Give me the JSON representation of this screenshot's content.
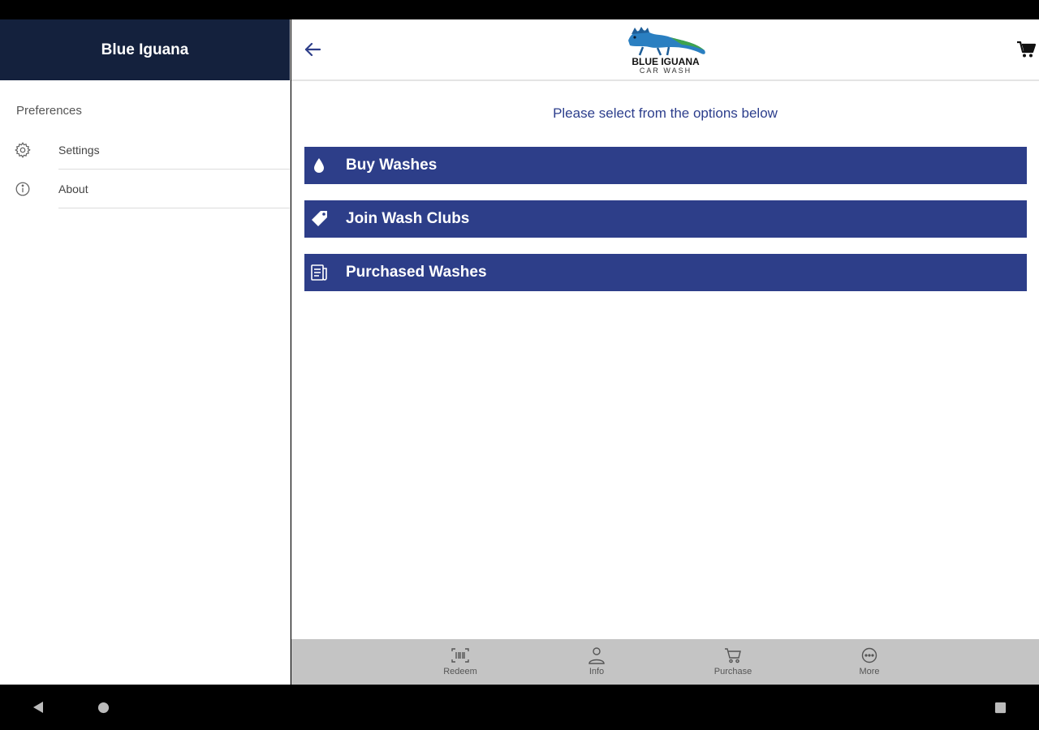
{
  "sidebar": {
    "title": "Blue Iguana",
    "section_label": "Preferences",
    "items": [
      {
        "label": "Settings",
        "icon": "gear-icon"
      },
      {
        "label": "About",
        "icon": "info-icon"
      }
    ]
  },
  "header": {
    "logo_top": "BLUE IGUANA",
    "logo_bottom": "CAR WASH"
  },
  "main": {
    "instructions": "Please select from the options below",
    "options": [
      {
        "label": "Buy Washes",
        "icon": "water-drop-icon"
      },
      {
        "label": "Join Wash Clubs",
        "icon": "tag-icon"
      },
      {
        "label": "Purchased Washes",
        "icon": "receipt-icon"
      }
    ]
  },
  "tabbar": {
    "tabs": [
      {
        "label": "Redeem",
        "icon": "barcode-scan-icon"
      },
      {
        "label": "Info",
        "icon": "person-icon"
      },
      {
        "label": "Purchase",
        "icon": "cart-icon"
      },
      {
        "label": "More",
        "icon": "more-icon"
      }
    ]
  },
  "colors": {
    "sidebar_header": "#14213d",
    "option_bg": "#2d3e89",
    "accent_text": "#2c3e8c",
    "tabbar_bg": "#c4c4c4"
  }
}
